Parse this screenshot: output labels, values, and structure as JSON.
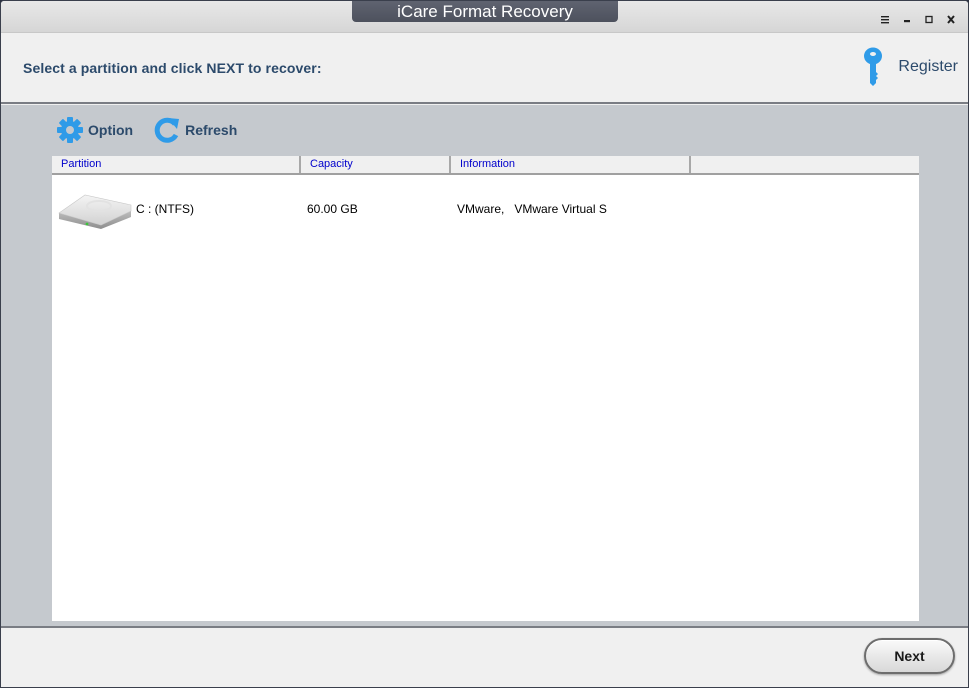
{
  "window": {
    "title": "iCare Format Recovery",
    "controls": [
      {
        "name": "menu",
        "icon": "menu-icon"
      },
      {
        "name": "minimize",
        "icon": "minimize-icon"
      },
      {
        "name": "maximize",
        "icon": "maximize-icon"
      },
      {
        "name": "close",
        "icon": "close-icon"
      }
    ]
  },
  "header": {
    "instruction": "Select a partition and click NEXT to recover:",
    "register_label": "Register",
    "register_icon": "key-icon"
  },
  "toolbar": {
    "option_label": "Option",
    "option_icon": "gear-icon",
    "refresh_label": "Refresh",
    "refresh_icon": "refresh-icon"
  },
  "table": {
    "columns": [
      "Partition",
      "Capacity",
      "Information",
      ""
    ],
    "rows": [
      {
        "icon": "hard-drive-icon",
        "partition": "C :   (NTFS)",
        "capacity": "60.00 GB",
        "information": "VMware,   VMware Virtual S"
      }
    ]
  },
  "footer": {
    "next_label": "Next"
  },
  "colors": {
    "accent_blue": "#2f9be8",
    "label_text": "#2c4a6b",
    "header_link": "#0000cc",
    "main_bg": "#c5c9ce"
  }
}
